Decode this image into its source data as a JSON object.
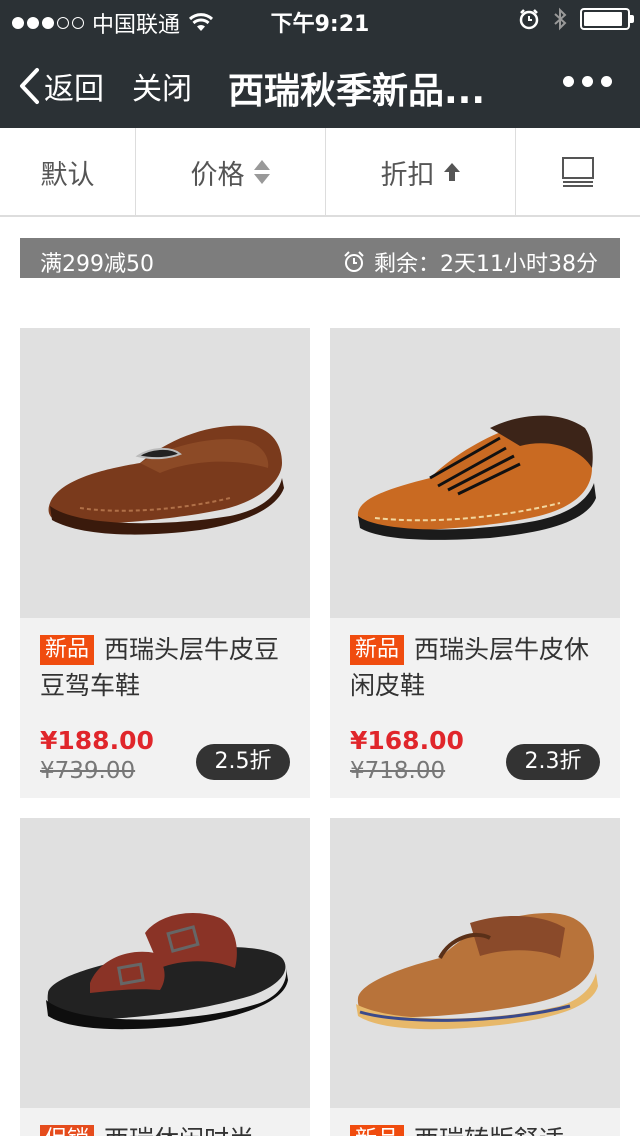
{
  "status": {
    "carrier": "中国联通",
    "time": "下午9:21",
    "battery_level": 0.9
  },
  "nav": {
    "back": "返回",
    "close": "关闭",
    "title": "西瑞秋季新品..."
  },
  "sort": {
    "default": "默认",
    "price": "价格",
    "discount": "折扣"
  },
  "promo": {
    "deal": "满299减50",
    "remaining": "剩余：2天11小时38分"
  },
  "products": [
    {
      "tag": "新品",
      "name": "西瑞头层牛皮豆豆驾车鞋",
      "price": "¥188.00",
      "original_price": "¥739.00",
      "discount": "2.5折"
    },
    {
      "tag": "新品",
      "name": "西瑞头层牛皮休闲皮鞋",
      "price": "¥168.00",
      "original_price": "¥718.00",
      "discount": "2.3折"
    },
    {
      "tag": "促销",
      "name": "西瑞休闲时尚",
      "price": "",
      "original_price": "",
      "discount": ""
    },
    {
      "tag": "新品",
      "name": "西瑞转版舒适",
      "price": "",
      "original_price": "",
      "discount": ""
    }
  ],
  "colors": {
    "nav_bg": "#2b3135",
    "price_red": "#e0262b",
    "tag_orange": "#f04c0f"
  }
}
